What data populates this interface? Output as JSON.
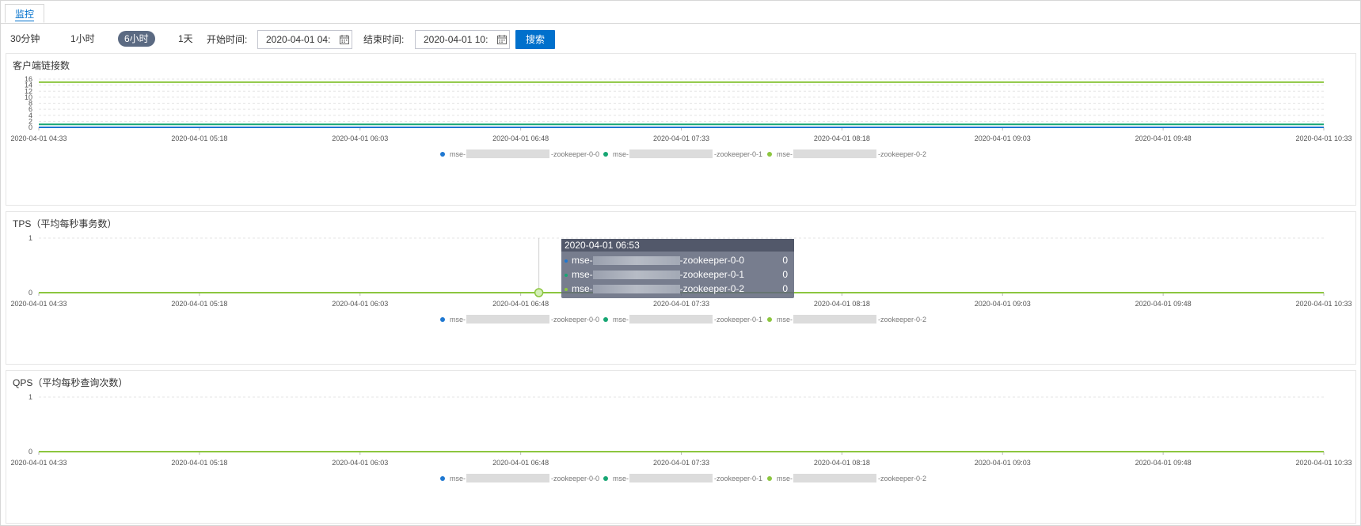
{
  "tabs": [
    {
      "label": "监控"
    }
  ],
  "toolbar": {
    "ranges": [
      "30分钟",
      "1小时",
      "6小时",
      "1天"
    ],
    "active_range": "6小时",
    "start_label": "开始时间:",
    "start_value": "2020-04-01 04:",
    "end_label": "结束时间:",
    "end_value": "2020-04-01 10:",
    "search_label": "搜索"
  },
  "series_colors": [
    "#1f78d1",
    "#17a673",
    "#8cc63f"
  ],
  "legend": {
    "prefix": "mse-",
    "suffixes": [
      "-zookeeper-0-0",
      "-zookeeper-0-1",
      "-zookeeper-0-2"
    ]
  },
  "x_ticks": [
    "2020-04-01 04:33",
    "2020-04-01 05:18",
    "2020-04-01 06:03",
    "2020-04-01 06:48",
    "2020-04-01 07:33",
    "2020-04-01 08:18",
    "2020-04-01 09:03",
    "2020-04-01 09:48",
    "2020-04-01 10:33"
  ],
  "chart_data": [
    {
      "type": "line",
      "title": "客户端链接数",
      "y_ticks": [
        "0",
        "2",
        "4",
        "6",
        "8",
        "10",
        "12",
        "14",
        "16"
      ],
      "ylim": [
        0,
        16
      ],
      "series": [
        {
          "name": "mse-…-zookeeper-0-0",
          "values": [
            0,
            0,
            0,
            0,
            0,
            0,
            0,
            0,
            0
          ]
        },
        {
          "name": "mse-…-zookeeper-0-1",
          "values": [
            1,
            1,
            1,
            1,
            1,
            1,
            1,
            1,
            1
          ]
        },
        {
          "name": "mse-…-zookeeper-0-2",
          "values": [
            15,
            15,
            15,
            15,
            15,
            15,
            15,
            15,
            15
          ]
        }
      ]
    },
    {
      "type": "line",
      "title": "TPS（平均每秒事务数）",
      "y_ticks": [
        "0",
        "1"
      ],
      "ylim": [
        0,
        1
      ],
      "series": [
        {
          "name": "mse-…-zookeeper-0-0",
          "values": [
            0,
            0,
            0,
            0,
            0,
            0,
            0,
            0,
            0
          ]
        },
        {
          "name": "mse-…-zookeeper-0-1",
          "values": [
            0,
            0,
            0,
            0,
            0,
            0,
            0,
            0,
            0
          ]
        },
        {
          "name": "mse-…-zookeeper-0-2",
          "values": [
            0,
            0,
            0,
            0,
            0,
            0,
            0,
            0,
            0
          ]
        }
      ]
    },
    {
      "type": "line",
      "title": "QPS（平均每秒查询次数）",
      "y_ticks": [
        "0",
        "1"
      ],
      "ylim": [
        0,
        1
      ],
      "series": [
        {
          "name": "mse-…-zookeeper-0-0",
          "values": [
            0,
            0,
            0,
            0,
            0,
            0,
            0,
            0,
            0
          ]
        },
        {
          "name": "mse-…-zookeeper-0-1",
          "values": [
            0,
            0,
            0,
            0,
            0,
            0,
            0,
            0,
            0
          ]
        },
        {
          "name": "mse-…-zookeeper-0-2",
          "values": [
            0,
            0,
            0,
            0,
            0,
            0,
            0,
            0,
            0
          ]
        }
      ]
    }
  ],
  "tooltip": {
    "title": "2020-04-01 06:53",
    "rows": [
      {
        "prefix": "mse-",
        "suffix": "-zookeeper-0-0",
        "value": "0"
      },
      {
        "prefix": "mse-",
        "suffix": "-zookeeper-0-1",
        "value": "0"
      },
      {
        "prefix": "mse-",
        "suffix": "-zookeeper-0-2",
        "value": "0"
      }
    ]
  }
}
